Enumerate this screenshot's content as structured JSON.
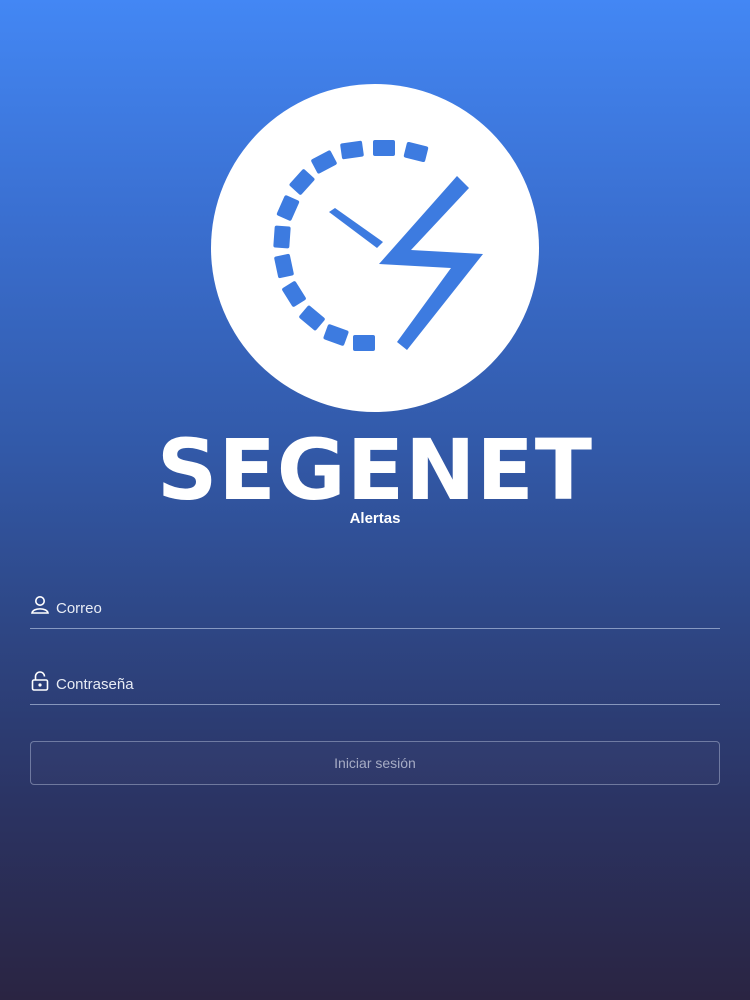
{
  "brand": {
    "name": "SEGENET",
    "subtitle": "Alertas",
    "logo_icon": "stopwatch-lightning-icon"
  },
  "form": {
    "email_placeholder": "Correo",
    "email_value": "",
    "email_icon": "user-icon",
    "password_placeholder": "Contraseña",
    "password_value": "",
    "password_icon": "lock-icon",
    "submit_label": "Iniciar sesión"
  },
  "colors": {
    "gradient_top": "#4387f4",
    "gradient_bottom": "#2a2442",
    "logo_accent": "#3d7be0",
    "text": "#ffffff"
  }
}
